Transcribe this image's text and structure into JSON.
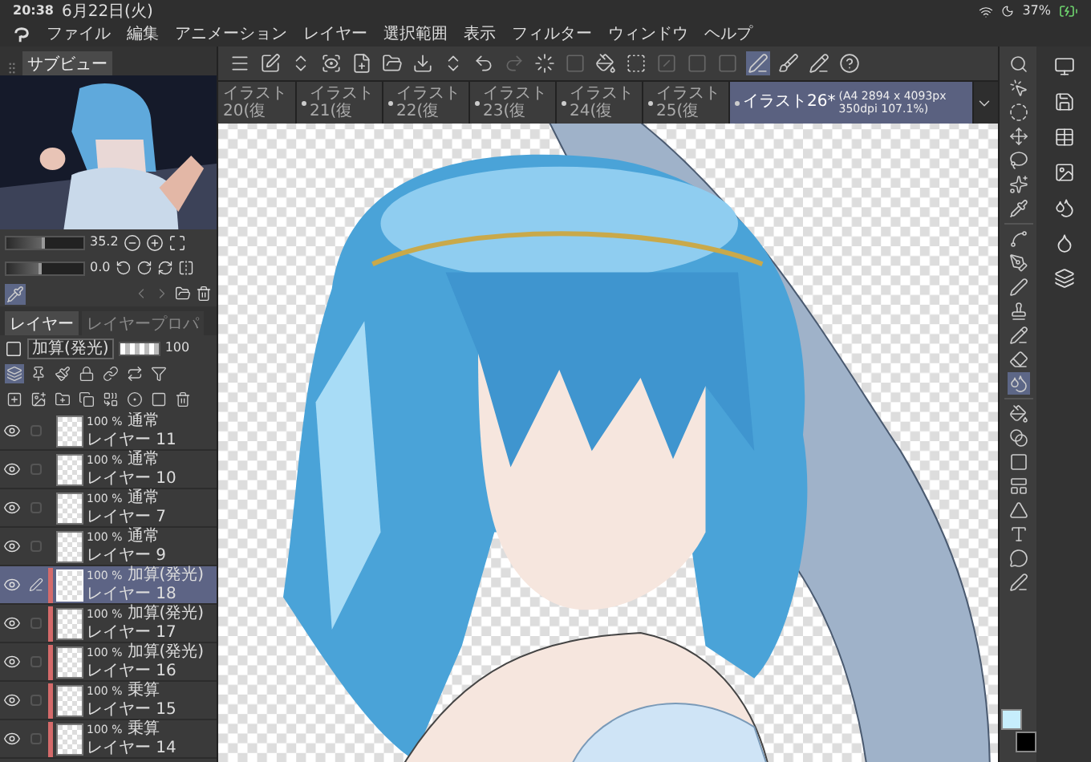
{
  "status_bar": {
    "time": "20:38",
    "date": "6月22日(火)",
    "battery": "37%"
  },
  "menu": {
    "items": [
      "ファイル",
      "編集",
      "アニメーション",
      "レイヤー",
      "選択範囲",
      "表示",
      "フィルター",
      "ウィンドウ",
      "ヘルプ"
    ]
  },
  "toolbar": {
    "buttons": [
      {
        "selected": false,
        "disabled": false
      },
      {
        "selected": false,
        "disabled": false
      },
      {
        "selected": false,
        "disabled": false
      },
      {
        "selected": false,
        "disabled": false
      },
      {
        "selected": false,
        "disabled": false
      },
      {
        "selected": false,
        "disabled": false
      },
      {
        "selected": false,
        "disabled": false
      },
      {
        "selected": false,
        "disabled": false
      },
      {
        "selected": false,
        "disabled": false
      },
      {
        "selected": false,
        "disabled": true
      },
      {
        "selected": false,
        "disabled": false
      },
      {
        "selected": false,
        "disabled": true
      },
      {
        "selected": false,
        "disabled": false
      },
      {
        "selected": false,
        "disabled": false
      },
      {
        "selected": false,
        "disabled": true
      },
      {
        "selected": false,
        "disabled": true
      },
      {
        "selected": false,
        "disabled": true
      },
      {
        "selected": true,
        "disabled": false
      },
      {
        "selected": false,
        "disabled": false
      },
      {
        "selected": false,
        "disabled": false
      },
      {
        "selected": false,
        "disabled": false
      }
    ]
  },
  "canvas_tabs": [
    {
      "title": "イラスト20(復",
      "modified": false,
      "selected": false
    },
    {
      "title": "イラスト21(復",
      "modified": true,
      "selected": false
    },
    {
      "title": "イラスト22(復",
      "modified": true,
      "selected": false
    },
    {
      "title": "イラスト23(復",
      "modified": true,
      "selected": false
    },
    {
      "title": "イラスト24(復",
      "modified": true,
      "selected": false
    },
    {
      "title": "イラスト25(復",
      "modified": true,
      "selected": false
    },
    {
      "title": "イラスト26*",
      "info": "(A4 2894 x 4093px 350dpi 107.1%)",
      "modified": true,
      "selected": true
    }
  ],
  "subview": {
    "title": "サブビュー",
    "zoom": {
      "level": 0.5,
      "reading": "35.2"
    },
    "rotation": {
      "level": 0.45,
      "reading": "0.0"
    }
  },
  "layer_panel": {
    "tabs": [
      {
        "label": "レイヤー",
        "selected": true
      },
      {
        "label": "レイヤープロパ",
        "selected": false
      }
    ],
    "blend_mode": "加算(発光)",
    "opacity": {
      "level": 1,
      "reading": "100"
    },
    "mode_buttons": [
      {
        "selected": true
      },
      {
        "selected": false
      },
      {
        "selected": false
      },
      {
        "selected": false
      },
      {
        "selected": false
      },
      {
        "selected": false
      },
      {
        "selected": false
      }
    ],
    "layers": [
      {
        "opacity": "100 %",
        "blend": "通常",
        "name": "レイヤー 11",
        "visible": true,
        "selected": false,
        "editing": false,
        "clipped": false
      },
      {
        "opacity": "100 %",
        "blend": "通常",
        "name": "レイヤー 10",
        "visible": true,
        "selected": false,
        "editing": false,
        "clipped": false
      },
      {
        "opacity": "100 %",
        "blend": "通常",
        "name": "レイヤー 7",
        "visible": true,
        "selected": false,
        "editing": false,
        "clipped": false
      },
      {
        "opacity": "100 %",
        "blend": "通常",
        "name": "レイヤー 9",
        "visible": true,
        "selected": false,
        "editing": false,
        "clipped": false
      },
      {
        "opacity": "100 %",
        "blend": "加算(発光)",
        "name": "レイヤー 18",
        "visible": true,
        "selected": true,
        "editing": true,
        "clipped": true
      },
      {
        "opacity": "100 %",
        "blend": "加算(発光)",
        "name": "レイヤー 17",
        "visible": true,
        "selected": false,
        "editing": false,
        "clipped": true
      },
      {
        "opacity": "100 %",
        "blend": "加算(発光)",
        "name": "レイヤー 16",
        "visible": true,
        "selected": false,
        "editing": false,
        "clipped": true
      },
      {
        "opacity": "100 %",
        "blend": "乗算",
        "name": "レイヤー 15",
        "visible": true,
        "selected": false,
        "editing": false,
        "clipped": true
      },
      {
        "opacity": "100 %",
        "blend": "乗算",
        "name": "レイヤー 14",
        "visible": true,
        "selected": false,
        "editing": false,
        "clipped": true
      }
    ]
  },
  "tools": [
    {
      "selected": false
    },
    {
      "selected": false
    },
    {
      "selected": false
    },
    {
      "selected": false
    },
    {
      "selected": false
    },
    {
      "selected": false
    },
    {
      "selected": false
    },
    {
      "selected": false
    },
    {
      "selected": false
    },
    {
      "selected": false
    },
    {
      "selected": false
    },
    {
      "selected": false
    },
    {
      "selected": false
    },
    {
      "selected": true
    },
    {
      "selected": false
    },
    {
      "selected": false
    },
    {
      "selected": false
    },
    {
      "selected": false
    },
    {
      "selected": false
    },
    {
      "selected": false
    },
    {
      "selected": false
    },
    {
      "selected": false
    }
  ],
  "color_swatches": [
    {
      "color": "#c6eefc"
    },
    {
      "color": "#000000"
    }
  ]
}
